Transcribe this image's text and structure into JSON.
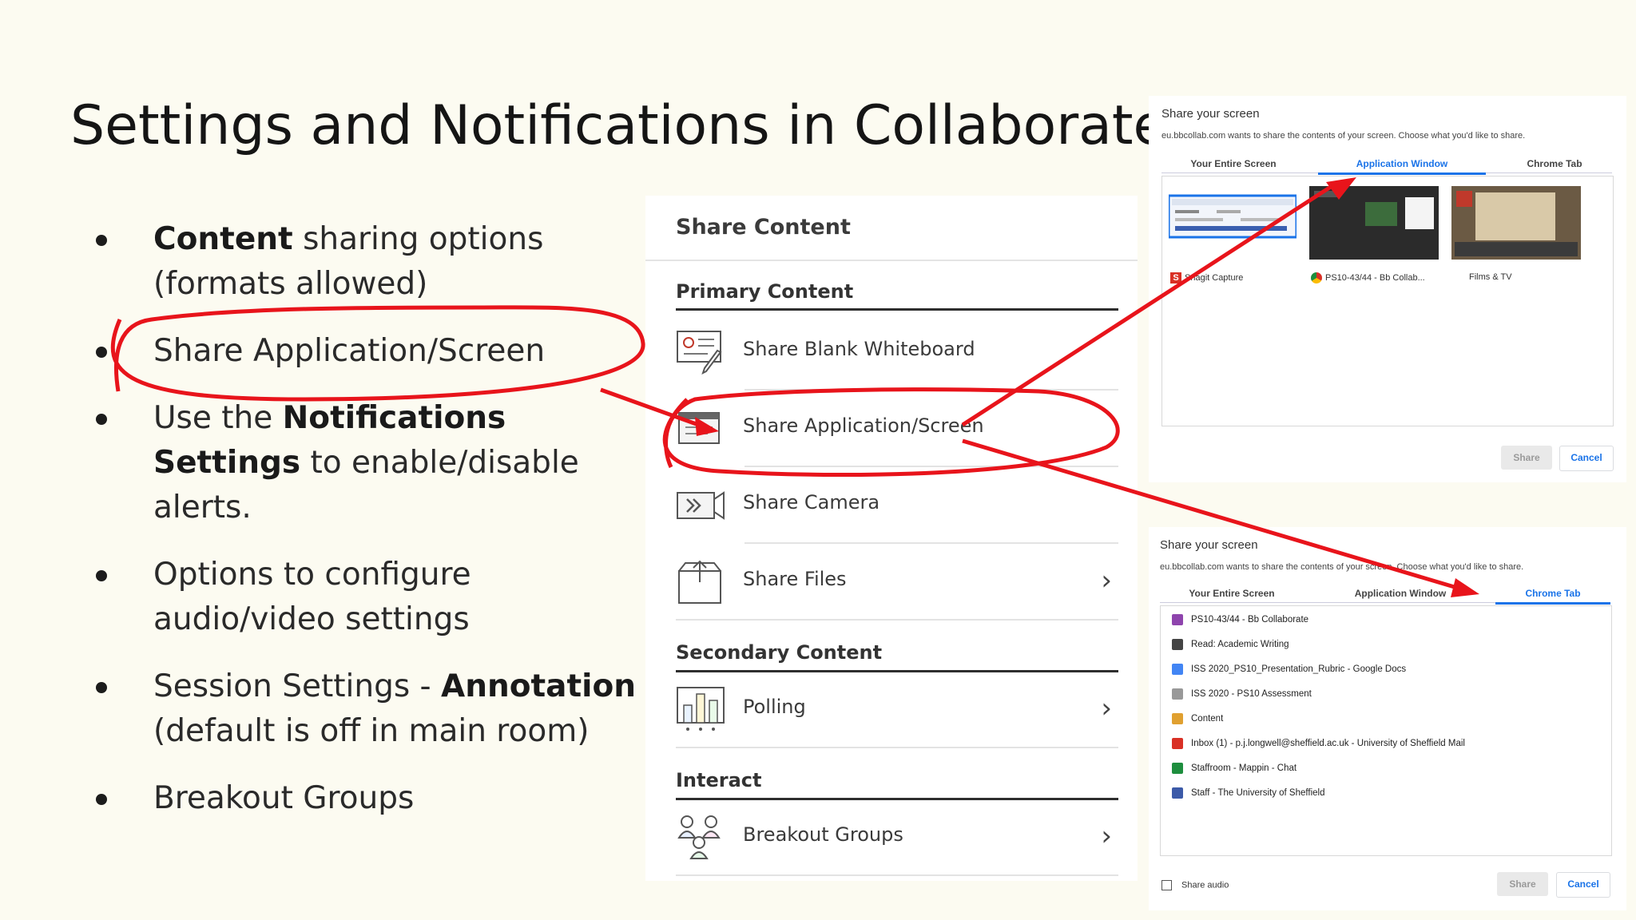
{
  "slide": {
    "title": "Settings and Notifications in Collaborate",
    "bullets": [
      {
        "bold": "Content",
        "text": " sharing options (formats allowed)"
      },
      {
        "pre": "Share Application/Screen"
      },
      {
        "pre": "Use the ",
        "bold": "Notifications Settings",
        "text": " to enable/disable alerts."
      },
      {
        "pre": "Options to configure audio/video settings"
      },
      {
        "pre": "Session Settings - ",
        "bold": "Annotation",
        "text": " (default is off in main room)"
      },
      {
        "pre": "Breakout Groups"
      }
    ]
  },
  "panel": {
    "header": "Share Content",
    "primary_label": "Primary Content",
    "secondary_label": "Secondary Content",
    "interact_label": "Interact",
    "items": {
      "whiteboard": "Share Blank Whiteboard",
      "appscreen": "Share Application/Screen",
      "camera": "Share Camera",
      "files": "Share Files",
      "polling": "Polling",
      "breakout": "Breakout Groups"
    }
  },
  "dialog1": {
    "title": "Share your screen",
    "subtitle": "eu.bbcollab.com wants to share the contents of your screen. Choose what you'd like to share.",
    "tabs": [
      "Your Entire Screen",
      "Application Window",
      "Chrome Tab"
    ],
    "active_tab": 1,
    "windows": [
      "Snagit Capture",
      "PS10-43/44 - Bb Collab...",
      "Films & TV"
    ],
    "share": "Share",
    "cancel": "Cancel"
  },
  "dialog2": {
    "title": "Share your screen",
    "subtitle": "eu.bbcollab.com wants to share the contents of your screen. Choose what you'd like to share.",
    "tabs": [
      "Your Entire Screen",
      "Application Window",
      "Chrome Tab"
    ],
    "active_tab": 2,
    "list": [
      {
        "icon": "collab-icon",
        "color": "#8e44ad",
        "label": "PS10-43/44 - Bb Collaborate"
      },
      {
        "icon": "globe-icon",
        "color": "#444444",
        "label": "Read: Academic Writing"
      },
      {
        "icon": "docs-icon",
        "color": "#4285f4",
        "label": "ISS 2020_PS10_Presentation_Rubric - Google Docs"
      },
      {
        "icon": "lines-icon",
        "color": "#999999",
        "label": "ISS 2020 - PS10 Assessment"
      },
      {
        "icon": "content-icon",
        "color": "#e0a030",
        "label": "Content"
      },
      {
        "icon": "gmail-icon",
        "color": "#d93025",
        "label": "Inbox (1) - p.j.longwell@sheffield.ac.uk - University of Sheffield Mail"
      },
      {
        "icon": "chat-icon",
        "color": "#1e8e3e",
        "label": "Staffroom - Mappin - Chat"
      },
      {
        "icon": "shield-icon",
        "color": "#3c5aa8",
        "label": "Staff - The University of Sheffield"
      }
    ],
    "share_audio": "Share audio",
    "share": "Share",
    "cancel": "Cancel"
  },
  "colors": {
    "annotation": "#e8141b",
    "accent": "#1a73e8"
  }
}
